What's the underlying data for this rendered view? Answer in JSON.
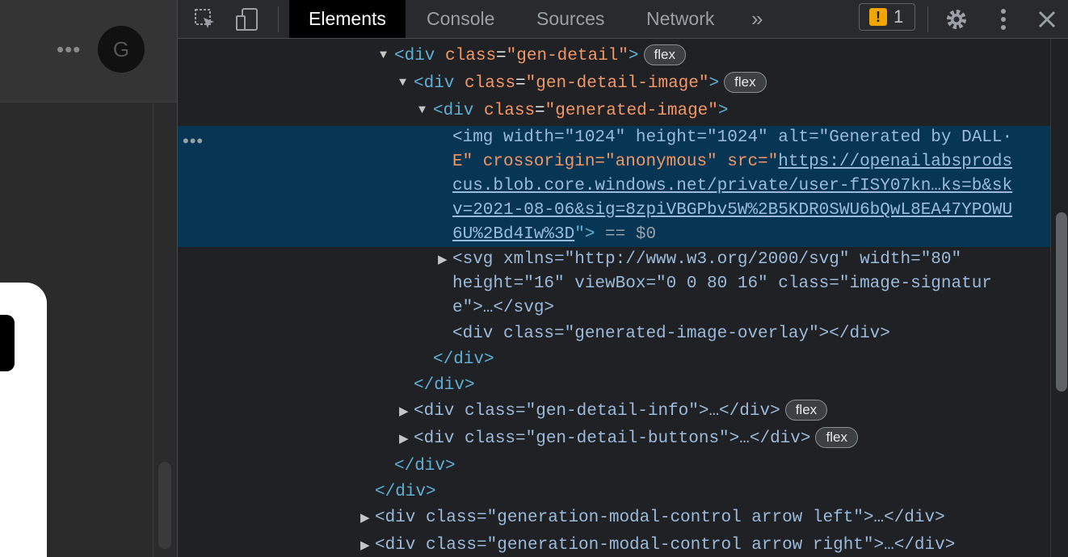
{
  "page": {
    "more_label": "•••",
    "avatar_letter": "G"
  },
  "devtools": {
    "tabs": [
      "Elements",
      "Console",
      "Sources",
      "Network"
    ],
    "more_tabs": "»",
    "issues_count": "1",
    "issues_icon": "!",
    "selected_ellipsis": "•••",
    "badge_label": "flex"
  },
  "tree": {
    "l1": {
      "tag_open": "<div",
      "attr": "class",
      "val": "\"gen-detail\"",
      "close": ">"
    },
    "l2": {
      "tag_open": "<div",
      "attr": "class",
      "val": "\"gen-detail-image\"",
      "close": ">"
    },
    "l3": {
      "tag_open": "<div",
      "attr": "class",
      "val": "\"generated-image\"",
      "close": ">"
    },
    "img": {
      "r1": "<img width=\"1024\" height=\"1024\" alt=\"Generated by DALL·",
      "r2_a": "E\" crossorigin=\"anonymous\" src=\"",
      "r2_link": "https://openailabsprods",
      "r3": "cus.blob.core.windows.net/private/user-fISY07kn…ks=b&sk",
      "r4": "v=2021-08-06&sig=8zpiVBGPbv5W%2B5KDR0SWU6bQwL8EA47YPOWU",
      "r5_link": "6U%2Bd4Iw%3D",
      "r5_tail": "\">",
      "r5_eq": " == $0"
    },
    "svg": {
      "r1": "<svg xmlns=\"http://www.w3.org/2000/svg\" width=\"80\"",
      "r2": "height=\"16\" viewBox=\"0 0 80 16\" class=\"image-signatur",
      "r3": "e\">…</svg>"
    },
    "overlay": "<div class=\"generated-image-overlay\"></div>",
    "close3": "</div>",
    "close2": "</div>",
    "info": "<div class=\"gen-detail-info\">…</div>",
    "buttons": "<div class=\"gen-detail-buttons\">…</div>",
    "close1a": "</div>",
    "close1b": "</div>",
    "left_arrow": "<div class=\"generation-modal-control arrow left\">…</div>",
    "right_arrow": "<div class=\"generation-modal-control arrow right\">…</div>"
  }
}
